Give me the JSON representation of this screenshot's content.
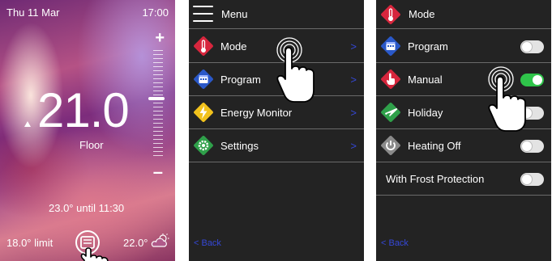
{
  "home": {
    "date": "Thu 11 Mar",
    "time": "17:00",
    "plus": "+",
    "minus": "–",
    "temperature": "21.0",
    "sensor": "Floor",
    "schedule": "23.0° until 11:30",
    "limit": "18.0° limit",
    "outdoor": "22.0°",
    "icons": [
      "thermostat-icon",
      "partly-cloudy-icon",
      "hand-pointer-icon"
    ]
  },
  "menu": {
    "header": "Menu",
    "items": [
      {
        "label": "Mode",
        "icon": "thermometer-icon",
        "color": "#d7263d"
      },
      {
        "label": "Program",
        "icon": "calendar-icon",
        "color": "#2a58c8"
      },
      {
        "label": "Energy Monitor",
        "icon": "lightning-icon",
        "color": "#f2c21c"
      },
      {
        "label": "Settings",
        "icon": "gear-icon",
        "color": "#2fa04a"
      }
    ],
    "chevron": ">",
    "back": "< Back"
  },
  "mode": {
    "header": "Mode",
    "items": [
      {
        "label": "Program",
        "icon": "calendar-icon",
        "color": "#2a58c8",
        "on": false
      },
      {
        "label": "Manual",
        "icon": "hand-icon",
        "color": "#d7263d",
        "on": true
      },
      {
        "label": "Holiday",
        "icon": "airplane-icon",
        "color": "#2fa04a",
        "on": false
      },
      {
        "label": "Heating Off",
        "icon": "power-icon",
        "color": "#8a8a8a",
        "on": false
      }
    ],
    "frost_label": "With Frost Protection",
    "frost_on": false,
    "back": "< Back"
  },
  "colors": {
    "accent_link": "#3548d8",
    "toggle_on": "#2fc44a",
    "toggle_off": "#e3e3e3"
  }
}
